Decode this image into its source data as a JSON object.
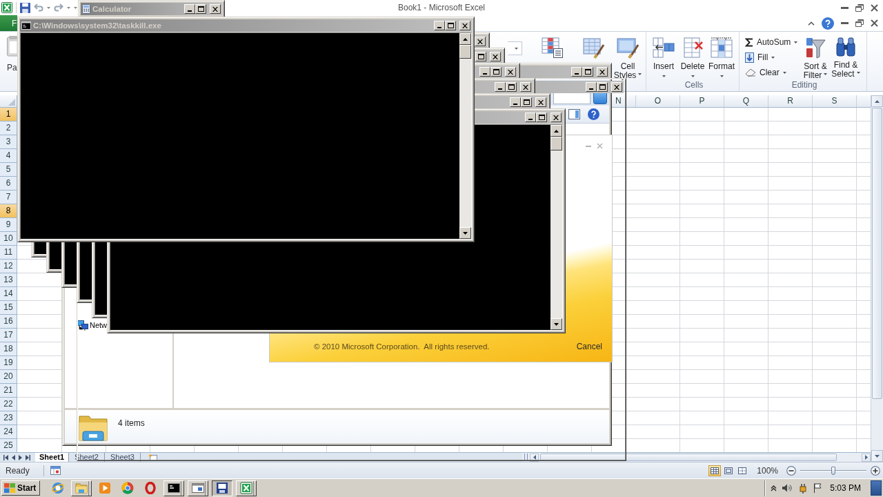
{
  "excel": {
    "title": "Book1 - Microsoft Excel",
    "file_tab": "F",
    "paste_label": "Pa",
    "styles_group": {
      "cell_styles": [
        "Cell",
        "Styles"
      ]
    },
    "cells_group": {
      "label": "Cells",
      "buttons": [
        {
          "kind": "insert",
          "label": "Insert"
        },
        {
          "kind": "delete",
          "label": "Delete"
        },
        {
          "kind": "format",
          "label": "Format"
        }
      ]
    },
    "editing_group": {
      "label": "Editing",
      "small_buttons": [
        {
          "kind": "sigma",
          "label": "AutoSum"
        },
        {
          "kind": "fill",
          "label": "Fill"
        },
        {
          "kind": "eraser",
          "label": "Clear"
        }
      ],
      "big_buttons": [
        {
          "kind": "sort",
          "lines": [
            "Sort &",
            "Filter"
          ]
        },
        {
          "kind": "find",
          "lines": [
            "Find &",
            "Select"
          ]
        }
      ]
    },
    "columns": [
      {
        "label": "N",
        "selected": false
      },
      {
        "label": "O",
        "selected": false
      },
      {
        "label": "P",
        "selected": false
      },
      {
        "label": "Q",
        "selected": false
      },
      {
        "label": "R",
        "selected": false
      },
      {
        "label": "S",
        "selected": false
      }
    ],
    "rows": [
      {
        "label": "1",
        "selected": true
      },
      {
        "label": "2",
        "selected": false
      },
      {
        "label": "3",
        "selected": false
      },
      {
        "label": "4",
        "selected": false
      },
      {
        "label": "5",
        "selected": false
      },
      {
        "label": "6",
        "selected": false
      },
      {
        "label": "7",
        "selected": false
      },
      {
        "label": "8",
        "selected": true
      },
      {
        "label": "9",
        "selected": false
      },
      {
        "label": "10",
        "selected": false
      },
      {
        "label": "11",
        "selected": false
      },
      {
        "label": "12",
        "selected": false
      },
      {
        "label": "13",
        "selected": false
      },
      {
        "label": "14",
        "selected": false
      },
      {
        "label": "15",
        "selected": false
      },
      {
        "label": "16",
        "selected": false
      },
      {
        "label": "17",
        "selected": false
      },
      {
        "label": "18",
        "selected": false
      },
      {
        "label": "19",
        "selected": false
      },
      {
        "label": "20",
        "selected": false
      },
      {
        "label": "21",
        "selected": false
      },
      {
        "label": "22",
        "selected": false
      },
      {
        "label": "23",
        "selected": false
      },
      {
        "label": "24",
        "selected": false
      },
      {
        "label": "25",
        "selected": false
      }
    ],
    "sheets": [
      {
        "label": "Sheet1",
        "selected": true
      },
      {
        "label": "Sheet2",
        "selected": false
      },
      {
        "label": "Sheet3",
        "selected": false
      }
    ],
    "status_bar": {
      "status": "Ready",
      "views": [
        {
          "kind": "normal",
          "selected": true
        },
        {
          "kind": "page-layout",
          "selected": false
        },
        {
          "kind": "page-break",
          "selected": false
        }
      ],
      "zoom": {
        "reading": "100%",
        "level": 0.5
      }
    }
  },
  "windows": {
    "explorer": {
      "nav_item": "Netw",
      "status": "4 items"
    },
    "splash": {
      "copyright": "© 2010 Microsoft Corporation.  All rights reserved.",
      "cancel": "Cancel"
    },
    "cascade": [
      {
        "kind": "console"
      },
      {
        "kind": "console"
      },
      {
        "kind": "console"
      },
      {
        "kind": "console"
      },
      {
        "kind": "console"
      },
      {
        "kind": "console"
      }
    ],
    "calculator": {
      "title": "Calculator"
    },
    "taskkill": {
      "title": "C:\\Windows\\system32\\taskkill.exe"
    }
  },
  "taskbar": {
    "start": "Start",
    "apps": [
      {
        "kind": "globe",
        "running": false,
        "selected": false
      },
      {
        "kind": "folder",
        "running": true,
        "selected": false
      },
      {
        "kind": "play",
        "running": false,
        "selected": false
      },
      {
        "kind": "wheel",
        "running": false,
        "selected": false
      },
      {
        "kind": "ring",
        "running": false,
        "selected": false
      },
      {
        "kind": "console",
        "running": true,
        "selected": false
      },
      {
        "kind": "panel",
        "running": true,
        "selected": false
      },
      {
        "kind": "screen",
        "running": true,
        "selected": true
      },
      {
        "kind": "sheet",
        "running": true,
        "selected": false
      }
    ],
    "clock": "5:03 PM"
  }
}
